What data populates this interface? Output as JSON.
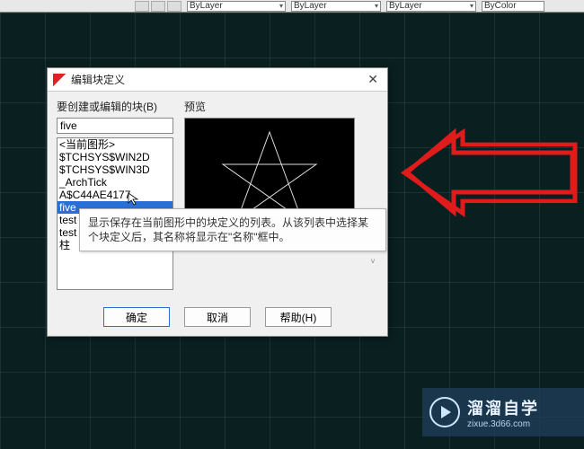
{
  "toolbar": {
    "dropdowns": [
      "ByLayer",
      "ByLayer",
      "ByLayer",
      "ByColor"
    ]
  },
  "dialog": {
    "title": "编辑块定义",
    "left_label": "要创建或编辑的块(B)",
    "name_value": "five",
    "preview_label": "预览",
    "list": {
      "items": [
        "<当前图形>",
        "$TCHSYS$WIN2D",
        "$TCHSYS$WIN3D",
        "_ArchTick",
        "A$C44AE4177",
        "five",
        "test",
        "test",
        "柱"
      ],
      "selected_index": 5
    },
    "tooltip": "显示保存在当前图形中的块定义的列表。从该列表中选择某个块定义后，其名称将显示在\"名称\"框中。",
    "buttons": {
      "ok": "确定",
      "cancel": "取消",
      "help": "帮助(H)"
    }
  },
  "watermark": {
    "brand": "溜溜自学",
    "url": "zixue.3d66.com"
  },
  "colors": {
    "selection": "#2a6fd6",
    "arrow": "#e01b1b"
  }
}
